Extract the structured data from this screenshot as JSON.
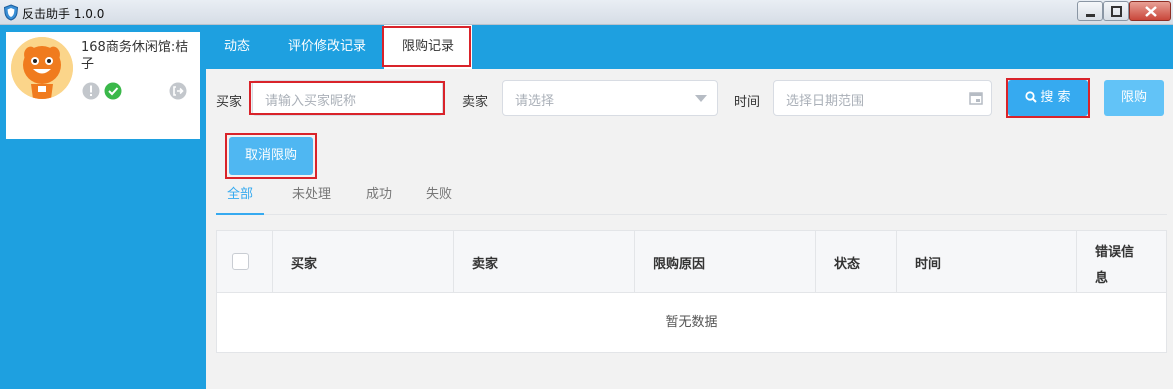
{
  "window": {
    "title": "反击助手 1.0.0"
  },
  "profile": {
    "shop_name": "168商务休闲馆:桔子",
    "status_icons": [
      "warning-icon",
      "check-icon",
      "logout-icon"
    ]
  },
  "topnav": {
    "tabs": [
      {
        "label": "动态"
      },
      {
        "label": "评价修改记录"
      },
      {
        "label": "限购记录"
      }
    ],
    "active_index": 2
  },
  "filters": {
    "buyer_label": "买家",
    "buyer_placeholder": "请输入买家昵称",
    "seller_label": "卖家",
    "seller_placeholder": "请选择",
    "time_label": "时间",
    "time_placeholder": "选择日期范围",
    "search_label": "搜 索",
    "limit_label": "限购"
  },
  "actions": {
    "cancel_limit_label": "取消限购"
  },
  "subtabs": {
    "items": [
      "全部",
      "未处理",
      "成功",
      "失败"
    ],
    "active_index": 0
  },
  "table": {
    "columns": [
      "买家",
      "卖家",
      "限购原因",
      "状态",
      "时间",
      "错误信息"
    ],
    "rows": [],
    "empty_text": "暂无数据"
  },
  "colors": {
    "accent": "#1ea0e0",
    "button": "#36aaf0",
    "highlight_box": "#d9232a"
  }
}
